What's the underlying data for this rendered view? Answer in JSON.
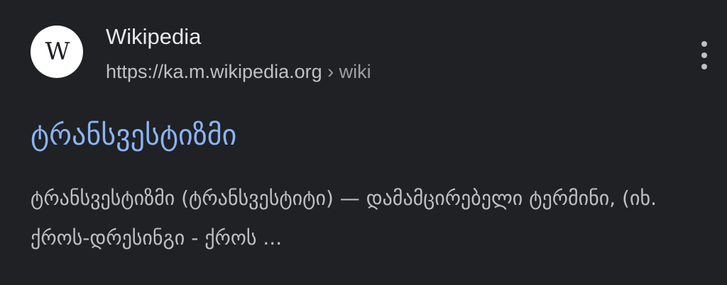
{
  "result": {
    "favicon_text": "W",
    "site_name": "Wikipedia",
    "url_base": "https://ka.m.wikipedia.org",
    "url_separator": " › ",
    "url_path": "wiki",
    "menu_icon": "more-vert-icon",
    "title": "ტრანსვესტიზმი",
    "snippet": "ტრანსვესტიზმი (ტრანსვესტიტი) — დამამცირებელი ტერმინი, (იხ. ქროს-დრესინგი - ქროს ..."
  },
  "colors": {
    "background": "#202124",
    "title_link": "#8ab4f8",
    "primary_text": "#e8eaed",
    "secondary_text": "#bdc1c6"
  }
}
